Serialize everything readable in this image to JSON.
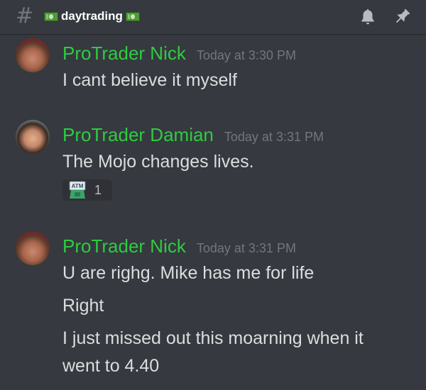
{
  "header": {
    "hash_symbol": "#",
    "channel_name": "daytrading",
    "icons": [
      "hash-icon",
      "money-bill-icon",
      "bell-icon",
      "pin-icon"
    ]
  },
  "colors": {
    "background": "#36393f",
    "author_green": "#2ecc40",
    "timestamp_gray": "#72767d",
    "text": "#dcddde",
    "reaction_bg": "#2f3136"
  },
  "messages": [
    {
      "author": "ProTrader Nick",
      "timestamp": "Today at 3:30 PM",
      "lines": [
        "I cant believe it myself"
      ]
    },
    {
      "author": "ProTrader Damian",
      "timestamp": "Today at 3:31 PM",
      "lines": [
        "The Mojo changes lives."
      ],
      "reaction": {
        "emoji": "atm-icon",
        "label": "ATM",
        "count": "1"
      }
    },
    {
      "author": "ProTrader Nick",
      "timestamp": "Today at 3:31 PM",
      "lines": [
        "U are righg.  Mike has me for life",
        "Right",
        "I just missed out this moarning when it",
        "went to 4.40"
      ]
    }
  ]
}
